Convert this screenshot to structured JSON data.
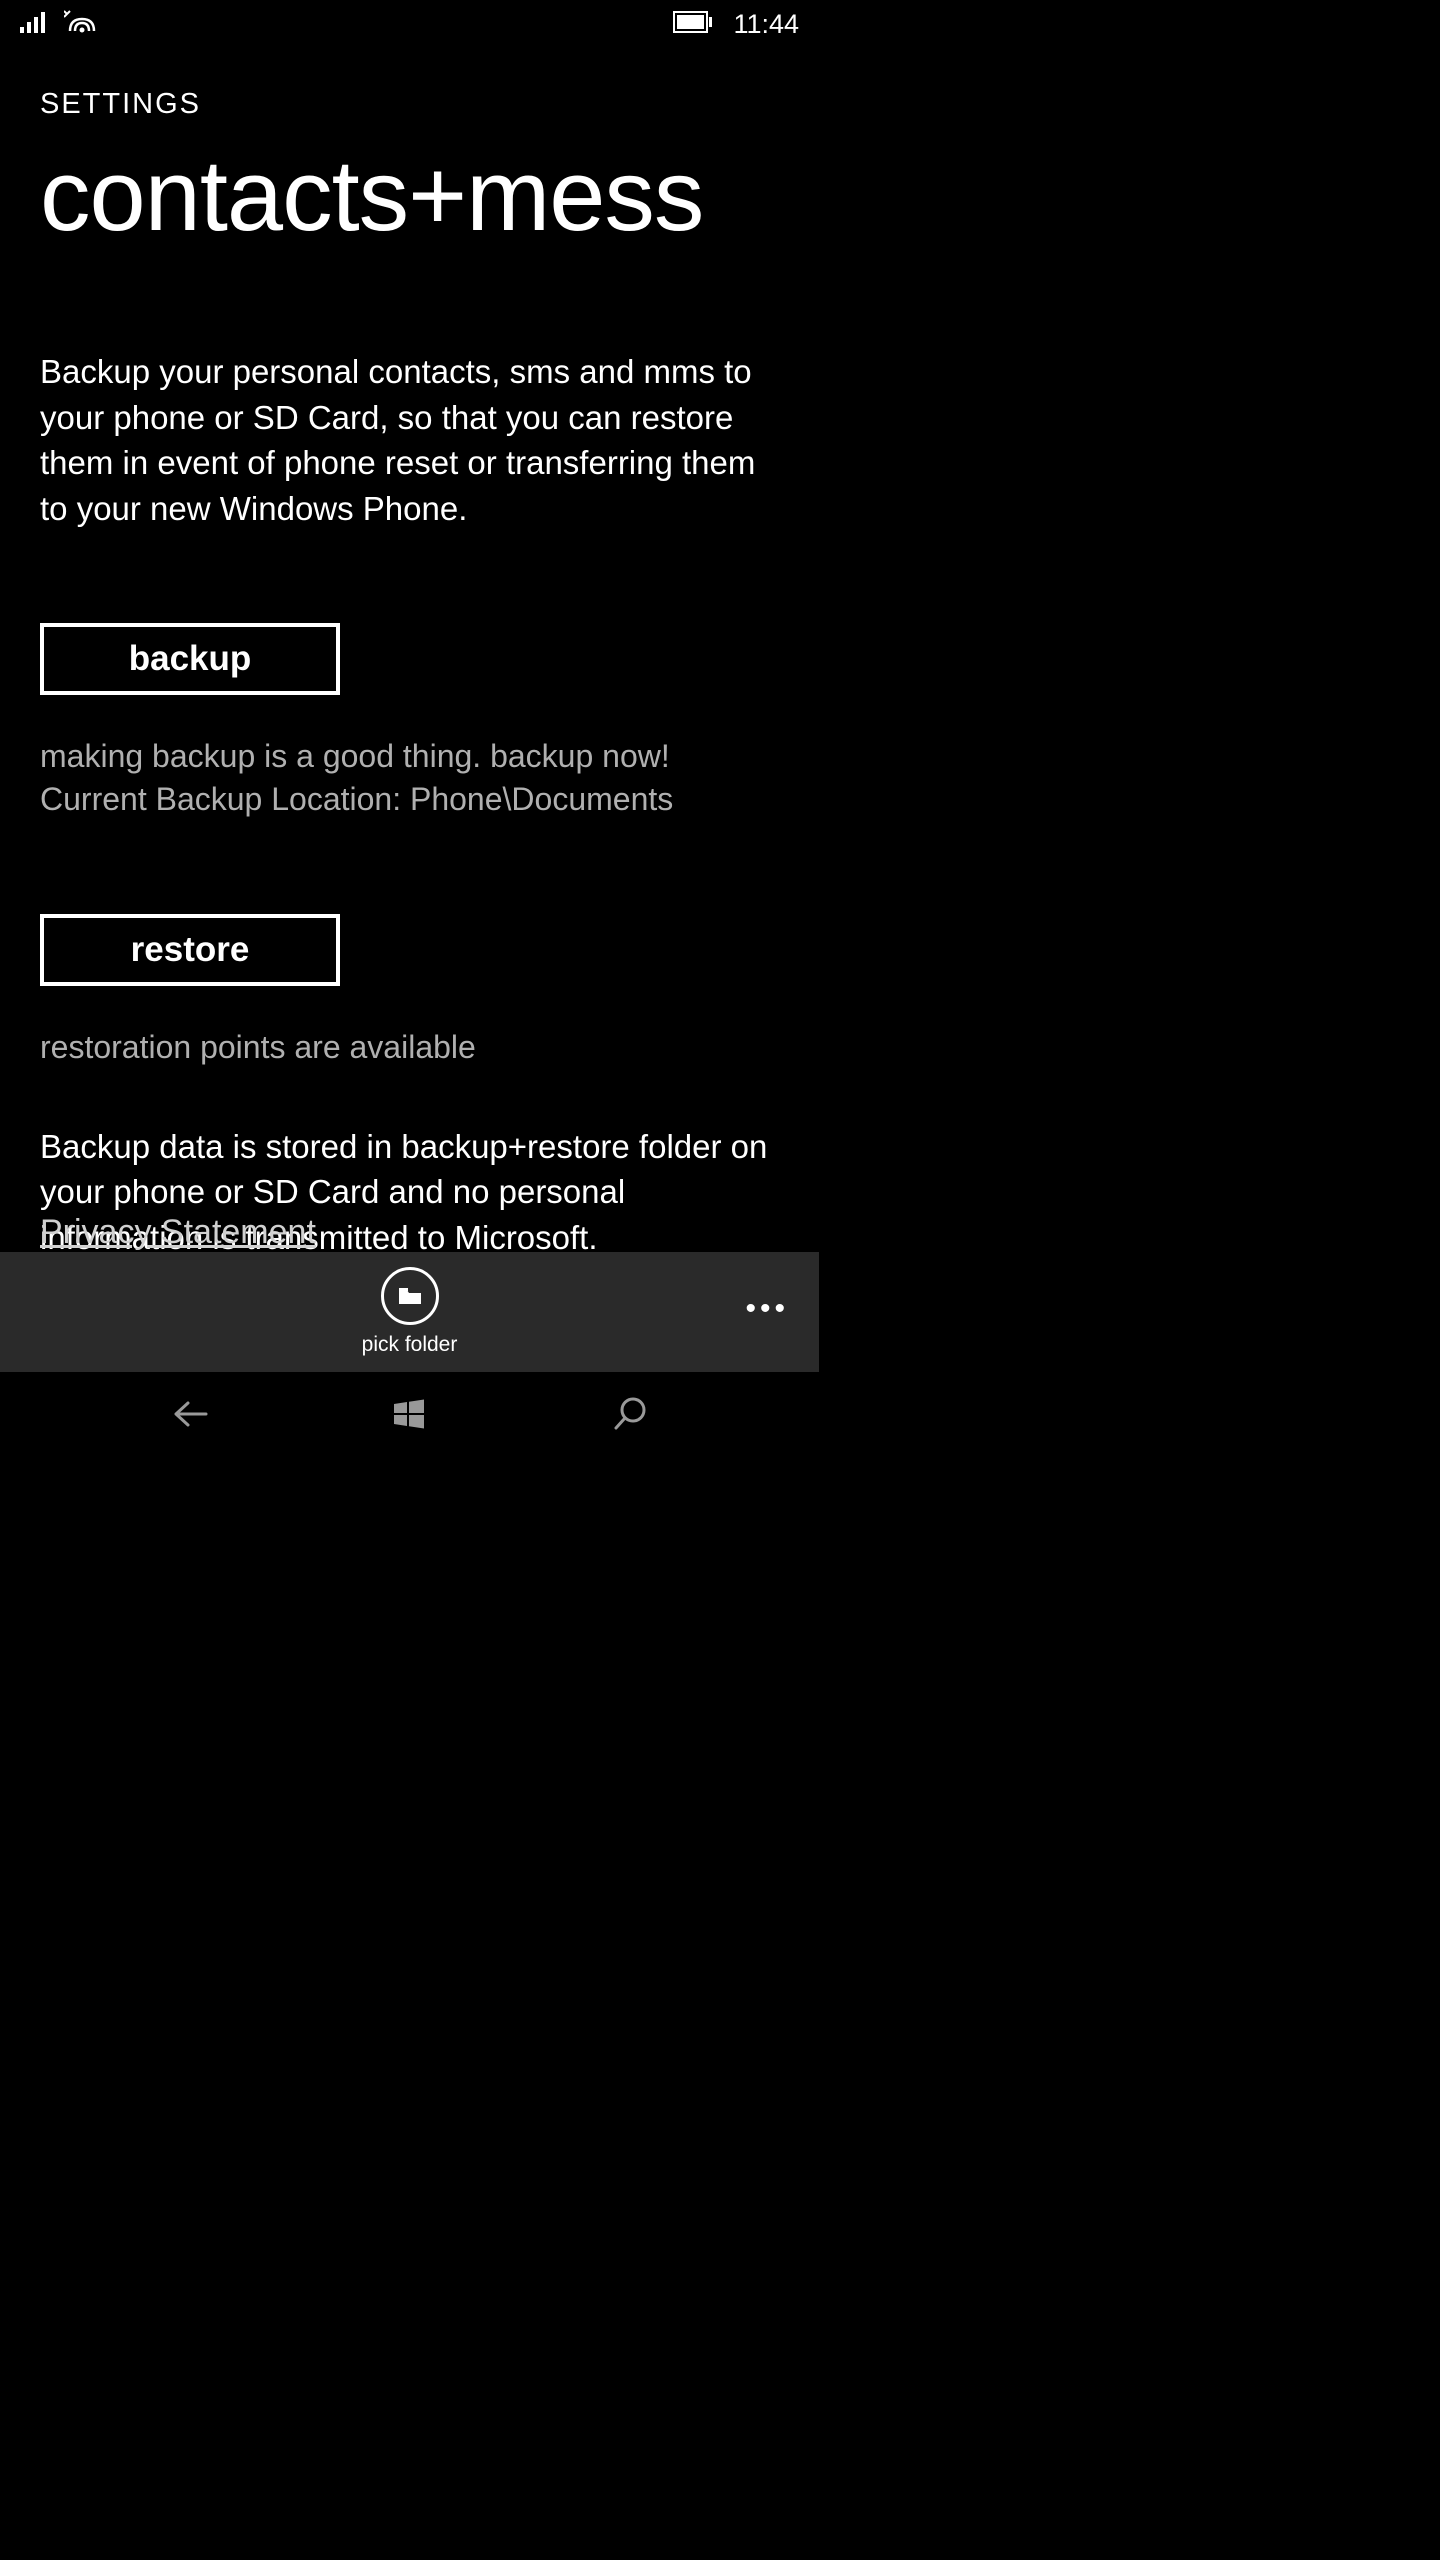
{
  "status": {
    "time": "11:44"
  },
  "header": {
    "small": "SETTINGS",
    "large": "contacts+mess"
  },
  "main": {
    "description": "Backup your personal contacts, sms and mms to your phone or SD Card, so that you can restore them in event of phone reset or transferring them to your new Windows Phone.",
    "backup_label": "backup",
    "backup_hint": "making backup is a good thing. backup now!\nCurrent Backup Location: Phone\\Documents",
    "restore_label": "restore",
    "restore_hint": "restoration points are available",
    "description2": "Backup data is stored in backup+restore folder on your phone or SD Card and no personal information is transmitted to Microsoft.",
    "privacy_link": "Privacy Statement"
  },
  "appbar": {
    "pick_folder_label": "pick folder"
  }
}
